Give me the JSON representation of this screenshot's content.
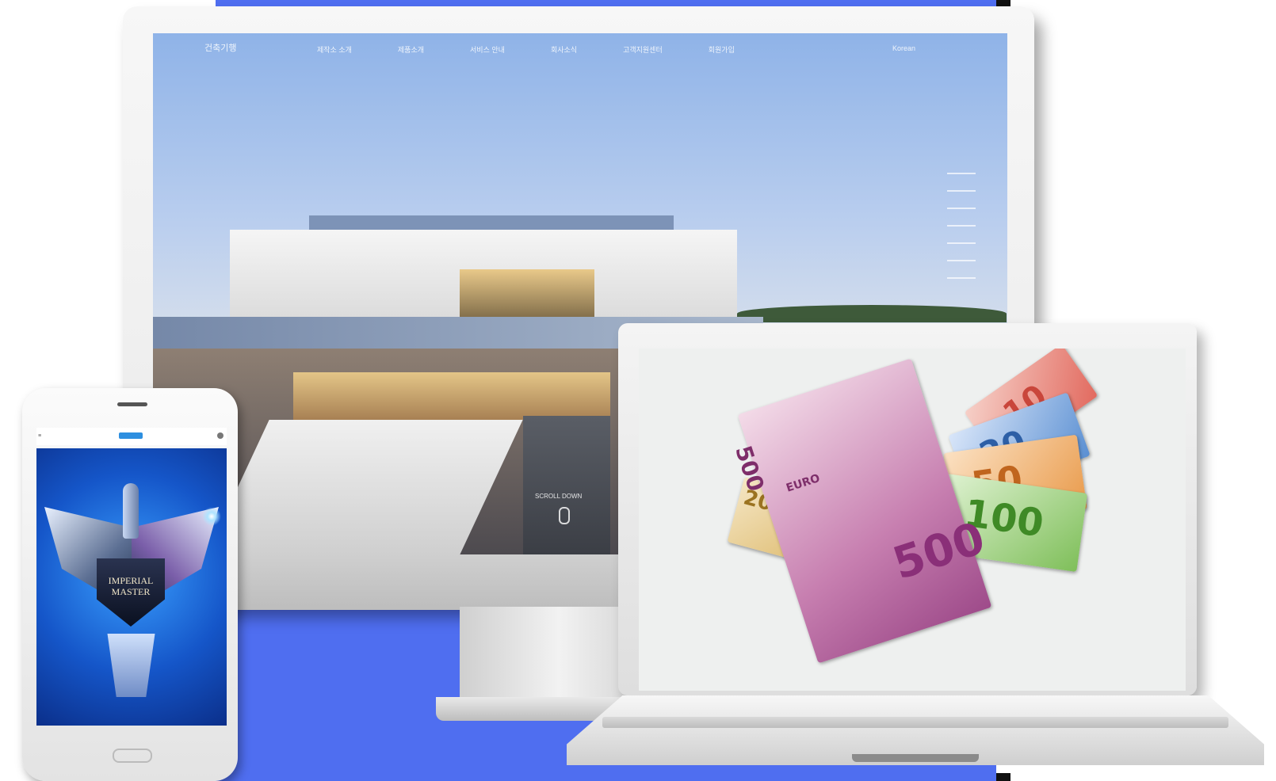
{
  "monitor_site": {
    "logo": "건축기행",
    "nav": [
      "제작소 소개",
      "제품소개",
      "서비스 안내",
      "회사소식",
      "고객지원센터",
      "회원가입"
    ],
    "lang": "Korean",
    "caption": "SCROLL DOWN"
  },
  "phone_screen": {
    "trophy_text_1": "IMPERIAL",
    "trophy_text_2": "MASTER"
  },
  "laptop_screen": {
    "notes": [
      {
        "value": "500",
        "label": "EURO",
        "color": "#b45a9b"
      },
      {
        "value": "200",
        "color": "#d9b35f"
      },
      {
        "value": "100",
        "color": "#7fbf5a"
      },
      {
        "value": "50",
        "color": "#e99a4a"
      },
      {
        "value": "20",
        "color": "#5a8fd2"
      },
      {
        "value": "10",
        "color": "#e26a5f"
      }
    ]
  },
  "colors": {
    "backdrop_blue": "#4f6ef0",
    "device_white": "#f4f4f4"
  }
}
